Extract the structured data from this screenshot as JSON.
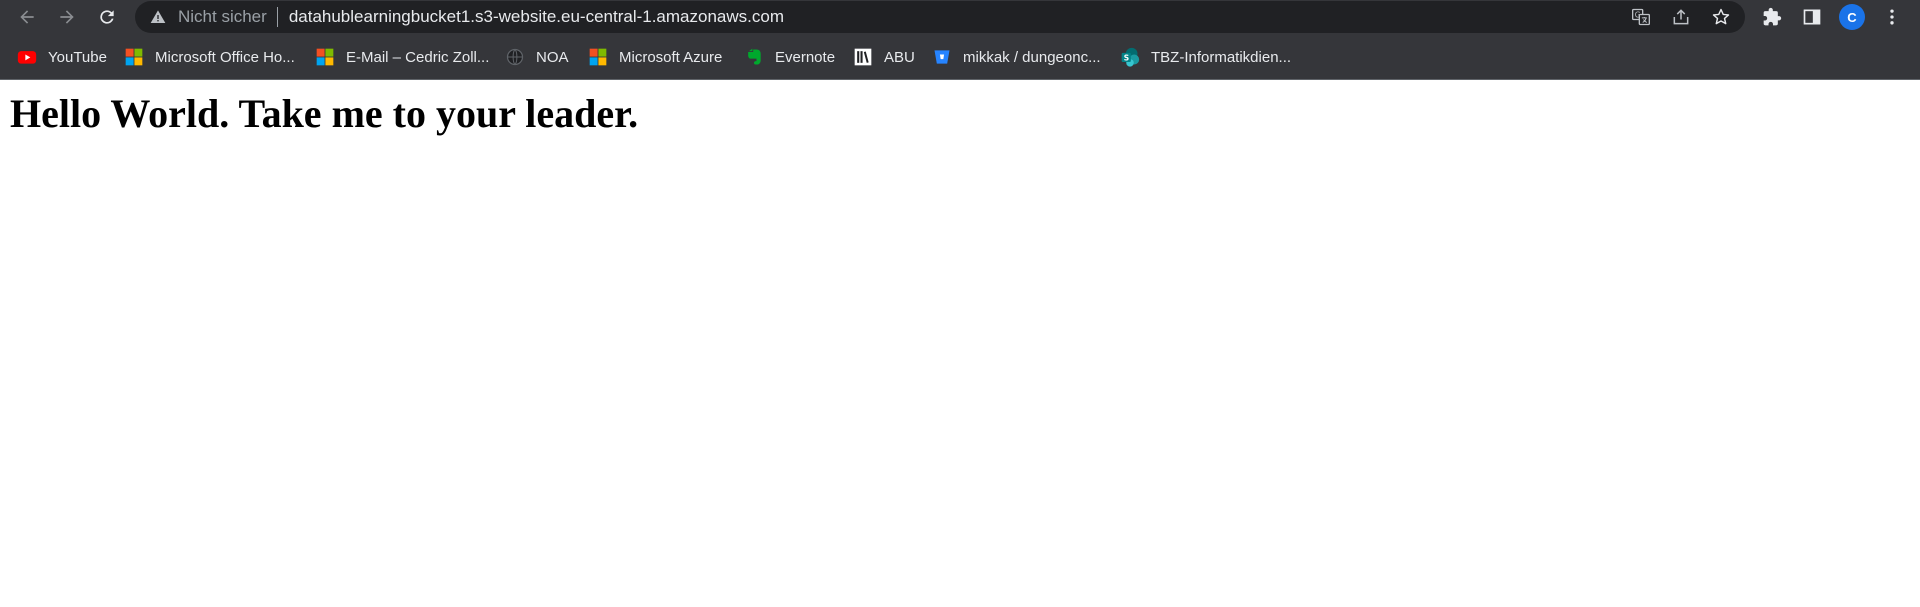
{
  "browser": {
    "omnibox": {
      "security_label": "Nicht sicher",
      "url": "datahublearningbucket1.s3-website.eu-central-1.amazonaws.com"
    },
    "profile_initial": "C"
  },
  "bookmarks": [
    {
      "label": "YouTube",
      "icon": "youtube-icon"
    },
    {
      "label": "Microsoft Office Ho...",
      "icon": "microsoft-logo-icon"
    },
    {
      "label": "E-Mail – Cedric Zoll...",
      "icon": "microsoft-logo-icon"
    },
    {
      "label": "NOA",
      "icon": "globe-icon"
    },
    {
      "label": "Microsoft Azure",
      "icon": "microsoft-logo-icon"
    },
    {
      "label": "Evernote",
      "icon": "evernote-icon"
    },
    {
      "label": "ABU",
      "icon": "library-icon"
    },
    {
      "label": "mikkak / dungeonc...",
      "icon": "bitbucket-icon"
    },
    {
      "label": "TBZ-Informatikdien...",
      "icon": "sharepoint-icon"
    }
  ],
  "page": {
    "heading": "Hello World. Take me to your leader."
  },
  "colors": {
    "toolbar_bg": "#35363a",
    "omnibox_bg": "#202124",
    "avatar_bg": "#1a73e8",
    "page_bg": "#ffffff"
  }
}
